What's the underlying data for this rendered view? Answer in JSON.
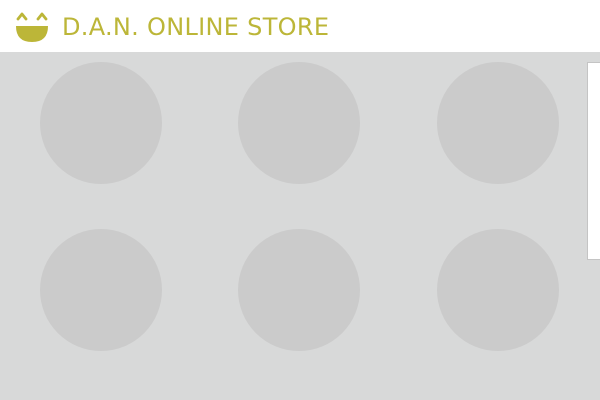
{
  "header": {
    "store_name": "D.A.N. ONLINE STORE",
    "logo_icon": "smiling-face-icon"
  },
  "catalog": {
    "product_count": 6
  },
  "colors": {
    "brand": "#bcb638",
    "catalog_background": "#d8d9d9",
    "tile_placeholder": "#cbcbcb"
  }
}
